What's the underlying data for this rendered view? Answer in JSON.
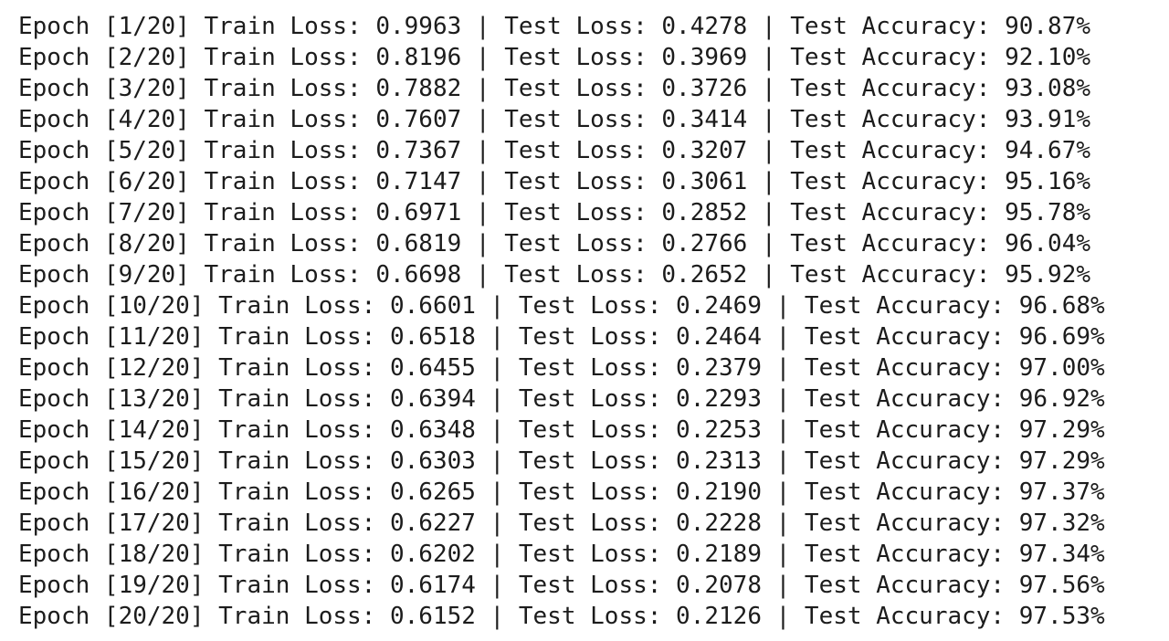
{
  "output": {
    "lines": [
      "Epoch [1/20] Train Loss: 0.9963 | Test Loss: 0.4278 | Test Accuracy: 90.87%",
      "Epoch [2/20] Train Loss: 0.8196 | Test Loss: 0.3969 | Test Accuracy: 92.10%",
      "Epoch [3/20] Train Loss: 0.7882 | Test Loss: 0.3726 | Test Accuracy: 93.08%",
      "Epoch [4/20] Train Loss: 0.7607 | Test Loss: 0.3414 | Test Accuracy: 93.91%",
      "Epoch [5/20] Train Loss: 0.7367 | Test Loss: 0.3207 | Test Accuracy: 94.67%",
      "Epoch [6/20] Train Loss: 0.7147 | Test Loss: 0.3061 | Test Accuracy: 95.16%",
      "Epoch [7/20] Train Loss: 0.6971 | Test Loss: 0.2852 | Test Accuracy: 95.78%",
      "Epoch [8/20] Train Loss: 0.6819 | Test Loss: 0.2766 | Test Accuracy: 96.04%",
      "Epoch [9/20] Train Loss: 0.6698 | Test Loss: 0.2652 | Test Accuracy: 95.92%",
      "Epoch [10/20] Train Loss: 0.6601 | Test Loss: 0.2469 | Test Accuracy: 96.68%",
      "Epoch [11/20] Train Loss: 0.6518 | Test Loss: 0.2464 | Test Accuracy: 96.69%",
      "Epoch [12/20] Train Loss: 0.6455 | Test Loss: 0.2379 | Test Accuracy: 97.00%",
      "Epoch [13/20] Train Loss: 0.6394 | Test Loss: 0.2293 | Test Accuracy: 96.92%",
      "Epoch [14/20] Train Loss: 0.6348 | Test Loss: 0.2253 | Test Accuracy: 97.29%",
      "Epoch [15/20] Train Loss: 0.6303 | Test Loss: 0.2313 | Test Accuracy: 97.29%",
      "Epoch [16/20] Train Loss: 0.6265 | Test Loss: 0.2190 | Test Accuracy: 97.37%",
      "Epoch [17/20] Train Loss: 0.6227 | Test Loss: 0.2228 | Test Accuracy: 97.32%",
      "Epoch [18/20] Train Loss: 0.6202 | Test Loss: 0.2189 | Test Accuracy: 97.34%",
      "Epoch [19/20] Train Loss: 0.6174 | Test Loss: 0.2078 | Test Accuracy: 97.56%",
      "Epoch [20/20] Train Loss: 0.6152 | Test Loss: 0.2126 | Test Accuracy: 97.53%"
    ]
  },
  "colors": {
    "background": "#ffffff",
    "text": "#1c1c1c"
  }
}
